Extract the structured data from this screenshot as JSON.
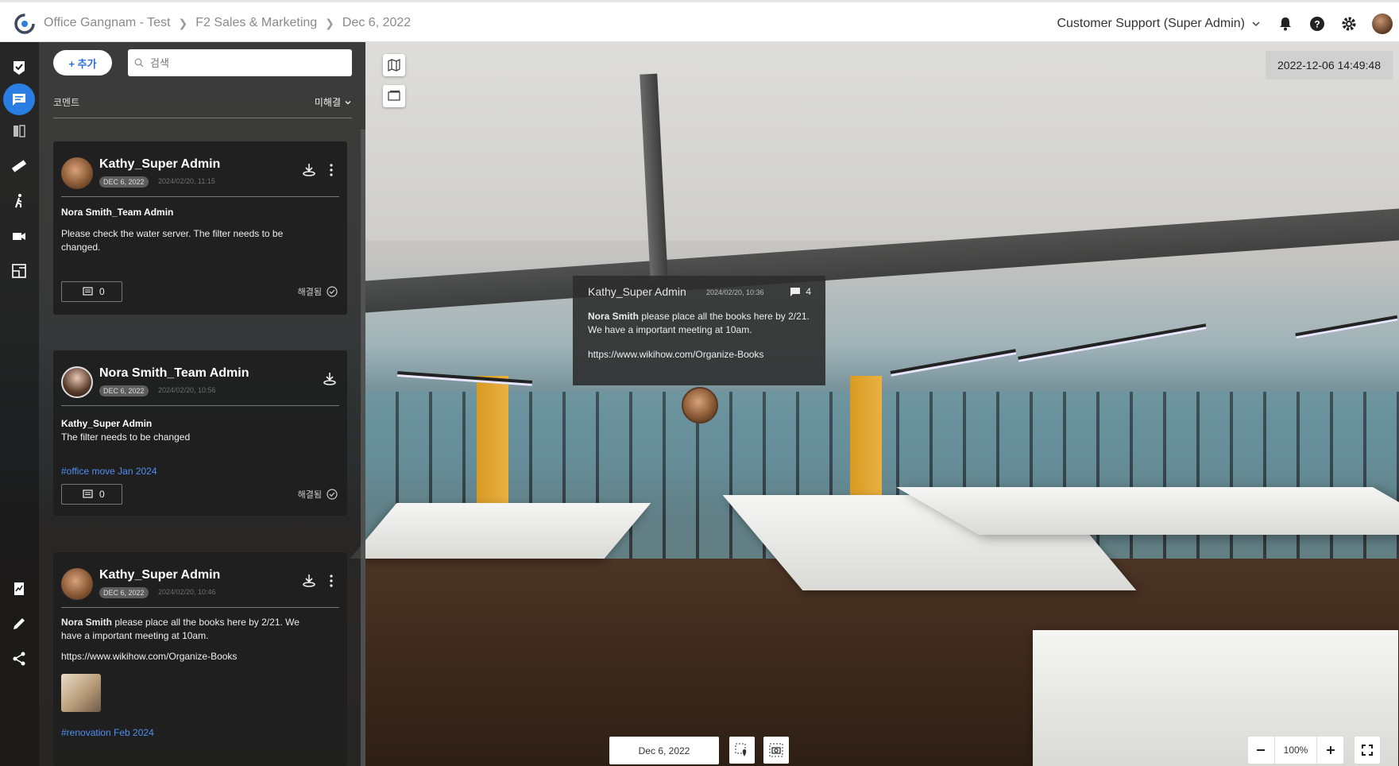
{
  "breadcrumb": [
    "Office Gangnam - Test",
    "F2 Sales & Marketing",
    "Dec 6, 2022"
  ],
  "header": {
    "org_selector": "Customer Support (Super Admin)"
  },
  "panel": {
    "add_label": "+ 추가",
    "search_placeholder": "검색",
    "section_label": "코멘트",
    "filter_value": "미해결",
    "comments": [
      {
        "author": "Kathy_Super Admin",
        "date_chip": "DEC 6, 2022",
        "timestamp": "2024/02/20, 11:15",
        "mention": "Nora Smith_Team Admin",
        "body": "Please check the water server. The filter needs to be changed.",
        "reply_count": "0",
        "status": "해결됨"
      },
      {
        "author": "Nora Smith_Team Admin",
        "date_chip": "DEC 6, 2022",
        "timestamp": "2024/02/20, 10:56",
        "mention": "Kathy_Super Admin",
        "body": "The filter needs to be changed",
        "tag": "#office move Jan 2024",
        "reply_count": "0",
        "status": "해결됨"
      },
      {
        "author": "Kathy_Super Admin",
        "date_chip": "DEC 6, 2022",
        "timestamp": "2024/02/20, 10:46",
        "mention_inline": "Nora Smith",
        "body": " please place all the books here by 2/21. We have a important meeting at 10am.",
        "link": "https://www.wikihow.com/Organize-Books",
        "tag": "#renovation Feb 2024"
      }
    ]
  },
  "viewer": {
    "capture_time": "2022-12-06 14:49:48",
    "popup": {
      "author": "Kathy_Super Admin",
      "timestamp": "2024/02/20, 10:36",
      "reply_count": "4",
      "mention": "Nora Smith",
      "text": " please place all the books here by 2/21. We have a important meeting at 10am.",
      "link": "https://www.wikihow.com/Organize-Books"
    },
    "date_selector": "Dec 6, 2022",
    "zoom": "100%"
  },
  "colors": {
    "accent": "#2a7de1",
    "tag": "#4f8ff0"
  }
}
